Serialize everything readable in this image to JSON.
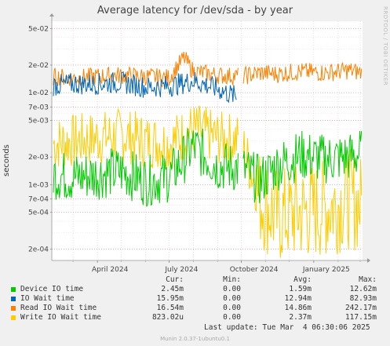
{
  "title": "Average latency for /dev/sda - by year",
  "side_label": "RRDTOOL / TOBI OETIKER",
  "chart_data": {
    "type": "line",
    "ylabel": "seconds",
    "yscale": "log",
    "ylim": [
      0.00015,
      0.06
    ],
    "ytick_labels": [
      "5e-02",
      "2e-02",
      "1e-02",
      "7e-03",
      "5e-03",
      "2e-03",
      "1e-03",
      "7e-04",
      "5e-04",
      "2e-04"
    ],
    "yticks": [
      0.05,
      0.02,
      0.01,
      0.007,
      0.005,
      0.002,
      0.001,
      0.0007,
      0.0005,
      0.0002
    ],
    "xlim": [
      "2024-02-03",
      "2025-03-04"
    ],
    "xtick_labels": [
      "April 2024",
      "July 2024",
      "October 2024",
      "January 2025"
    ],
    "xticks": [
      "2024-04-01",
      "2024-07-01",
      "2024-10-01",
      "2025-01-01"
    ],
    "grid": true,
    "series": [
      {
        "name": "Device IO time",
        "color": "#00cc00",
        "x": [
          "2024-02-05",
          "2024-03-01",
          "2024-04-01",
          "2024-05-01",
          "2024-06-01",
          "2024-07-01",
          "2024-08-01",
          "2024-09-01",
          "2024-10-01",
          "2024-10-25",
          "2024-11-15",
          "2024-12-15",
          "2025-01-15",
          "2025-02-15",
          "2025-03-03"
        ],
        "values": [
          0.0013,
          0.0012,
          0.0013,
          0.0014,
          0.0011,
          0.0012,
          0.0026,
          0.0016,
          0.0015,
          0.0011,
          0.0016,
          0.0021,
          0.0019,
          0.002,
          0.0022
        ]
      },
      {
        "name": "IO Wait time",
        "color": "#0066b3",
        "x": [
          "2024-02-05",
          "2024-03-01",
          "2024-04-01",
          "2024-05-01",
          "2024-06-01",
          "2024-07-01",
          "2024-08-01",
          "2024-09-01",
          "2024-09-25"
        ],
        "values": [
          0.012,
          0.0125,
          0.0125,
          0.013,
          0.0115,
          0.0118,
          0.0135,
          0.011,
          0.009
        ]
      },
      {
        "name": "Read IO Wait time",
        "color": "#ff8000",
        "x": [
          "2024-02-05",
          "2024-03-01",
          "2024-04-01",
          "2024-05-01",
          "2024-06-01",
          "2024-07-01",
          "2024-07-20",
          "2024-08-01",
          "2024-09-01",
          "2024-10-01",
          "2024-10-25",
          "2024-11-15",
          "2024-12-15",
          "2025-01-15",
          "2025-02-15",
          "2025-03-03"
        ],
        "values": [
          0.015,
          0.0145,
          0.015,
          0.0155,
          0.015,
          0.0145,
          0.024,
          0.017,
          0.0155,
          0.015,
          0.0165,
          0.016,
          0.017,
          0.0165,
          0.0175,
          0.0165
        ]
      },
      {
        "name": "Write IO Wait time",
        "color": "#ffcc00",
        "x": [
          "2024-02-05",
          "2024-03-01",
          "2024-04-01",
          "2024-05-01",
          "2024-06-01",
          "2024-07-01",
          "2024-08-01",
          "2024-09-01",
          "2024-10-01",
          "2024-10-25",
          "2024-11-15",
          "2024-12-15",
          "2025-01-15",
          "2025-02-15",
          "2025-03-03"
        ],
        "values": [
          0.0028,
          0.003,
          0.0032,
          0.0035,
          0.003,
          0.0028,
          0.004,
          0.0032,
          0.003,
          0.0007,
          0.00045,
          0.0005,
          0.00055,
          0.0007,
          0.0006
        ]
      }
    ]
  },
  "legend": {
    "headers": {
      "cur": "Cur:",
      "min": "Min:",
      "avg": "Avg:",
      "max": "Max:"
    },
    "rows": [
      {
        "name": "Device IO time",
        "color": "#00cc00",
        "cur": "2.45m",
        "min": "0.00",
        "avg": "1.59m",
        "max": "12.62m"
      },
      {
        "name": "IO Wait time",
        "color": "#0066b3",
        "cur": "15.95m",
        "min": "0.00",
        "avg": "12.94m",
        "max": "82.93m"
      },
      {
        "name": "Read IO Wait time",
        "color": "#ff8000",
        "cur": "16.54m",
        "min": "0.00",
        "avg": "14.86m",
        "max": "242.17m"
      },
      {
        "name": "Write IO Wait time",
        "color": "#ffcc00",
        "cur": "823.02u",
        "min": "0.00",
        "avg": "2.37m",
        "max": "117.15m"
      }
    ]
  },
  "last_update": "Last update: Tue Mar  4 06:30:06 2025",
  "footer": "Munin 2.0.37-1ubuntu0.1"
}
